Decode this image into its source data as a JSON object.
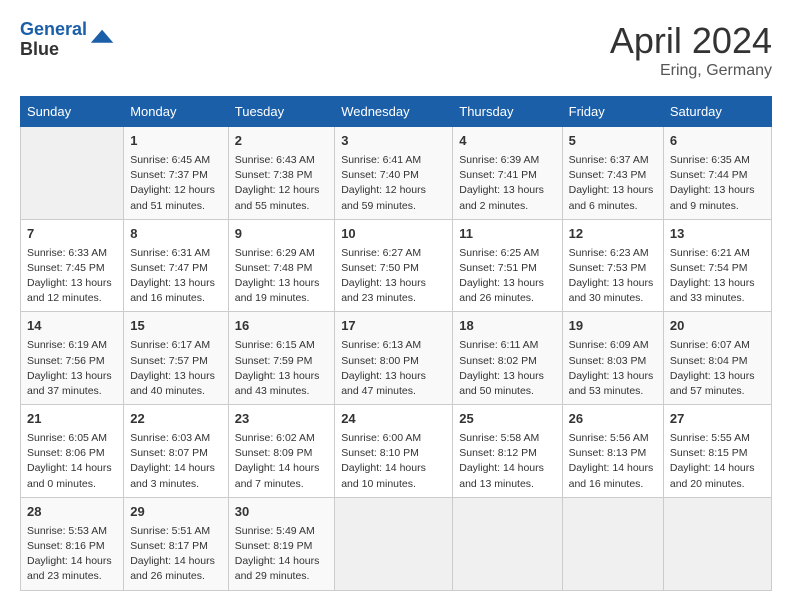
{
  "header": {
    "logo_line1": "General",
    "logo_line2": "Blue",
    "month": "April 2024",
    "location": "Ering, Germany"
  },
  "weekdays": [
    "Sunday",
    "Monday",
    "Tuesday",
    "Wednesday",
    "Thursday",
    "Friday",
    "Saturday"
  ],
  "weeks": [
    [
      {
        "day": "",
        "empty": true
      },
      {
        "day": "1",
        "sunrise": "6:45 AM",
        "sunset": "7:37 PM",
        "daylight": "12 hours and 51 minutes."
      },
      {
        "day": "2",
        "sunrise": "6:43 AM",
        "sunset": "7:38 PM",
        "daylight": "12 hours and 55 minutes."
      },
      {
        "day": "3",
        "sunrise": "6:41 AM",
        "sunset": "7:40 PM",
        "daylight": "12 hours and 59 minutes."
      },
      {
        "day": "4",
        "sunrise": "6:39 AM",
        "sunset": "7:41 PM",
        "daylight": "13 hours and 2 minutes."
      },
      {
        "day": "5",
        "sunrise": "6:37 AM",
        "sunset": "7:43 PM",
        "daylight": "13 hours and 6 minutes."
      },
      {
        "day": "6",
        "sunrise": "6:35 AM",
        "sunset": "7:44 PM",
        "daylight": "13 hours and 9 minutes."
      }
    ],
    [
      {
        "day": "7",
        "sunrise": "6:33 AM",
        "sunset": "7:45 PM",
        "daylight": "13 hours and 12 minutes."
      },
      {
        "day": "8",
        "sunrise": "6:31 AM",
        "sunset": "7:47 PM",
        "daylight": "13 hours and 16 minutes."
      },
      {
        "day": "9",
        "sunrise": "6:29 AM",
        "sunset": "7:48 PM",
        "daylight": "13 hours and 19 minutes."
      },
      {
        "day": "10",
        "sunrise": "6:27 AM",
        "sunset": "7:50 PM",
        "daylight": "13 hours and 23 minutes."
      },
      {
        "day": "11",
        "sunrise": "6:25 AM",
        "sunset": "7:51 PM",
        "daylight": "13 hours and 26 minutes."
      },
      {
        "day": "12",
        "sunrise": "6:23 AM",
        "sunset": "7:53 PM",
        "daylight": "13 hours and 30 minutes."
      },
      {
        "day": "13",
        "sunrise": "6:21 AM",
        "sunset": "7:54 PM",
        "daylight": "13 hours and 33 minutes."
      }
    ],
    [
      {
        "day": "14",
        "sunrise": "6:19 AM",
        "sunset": "7:56 PM",
        "daylight": "13 hours and 37 minutes."
      },
      {
        "day": "15",
        "sunrise": "6:17 AM",
        "sunset": "7:57 PM",
        "daylight": "13 hours and 40 minutes."
      },
      {
        "day": "16",
        "sunrise": "6:15 AM",
        "sunset": "7:59 PM",
        "daylight": "13 hours and 43 minutes."
      },
      {
        "day": "17",
        "sunrise": "6:13 AM",
        "sunset": "8:00 PM",
        "daylight": "13 hours and 47 minutes."
      },
      {
        "day": "18",
        "sunrise": "6:11 AM",
        "sunset": "8:02 PM",
        "daylight": "13 hours and 50 minutes."
      },
      {
        "day": "19",
        "sunrise": "6:09 AM",
        "sunset": "8:03 PM",
        "daylight": "13 hours and 53 minutes."
      },
      {
        "day": "20",
        "sunrise": "6:07 AM",
        "sunset": "8:04 PM",
        "daylight": "13 hours and 57 minutes."
      }
    ],
    [
      {
        "day": "21",
        "sunrise": "6:05 AM",
        "sunset": "8:06 PM",
        "daylight": "14 hours and 0 minutes."
      },
      {
        "day": "22",
        "sunrise": "6:03 AM",
        "sunset": "8:07 PM",
        "daylight": "14 hours and 3 minutes."
      },
      {
        "day": "23",
        "sunrise": "6:02 AM",
        "sunset": "8:09 PM",
        "daylight": "14 hours and 7 minutes."
      },
      {
        "day": "24",
        "sunrise": "6:00 AM",
        "sunset": "8:10 PM",
        "daylight": "14 hours and 10 minutes."
      },
      {
        "day": "25",
        "sunrise": "5:58 AM",
        "sunset": "8:12 PM",
        "daylight": "14 hours and 13 minutes."
      },
      {
        "day": "26",
        "sunrise": "5:56 AM",
        "sunset": "8:13 PM",
        "daylight": "14 hours and 16 minutes."
      },
      {
        "day": "27",
        "sunrise": "5:55 AM",
        "sunset": "8:15 PM",
        "daylight": "14 hours and 20 minutes."
      }
    ],
    [
      {
        "day": "28",
        "sunrise": "5:53 AM",
        "sunset": "8:16 PM",
        "daylight": "14 hours and 23 minutes."
      },
      {
        "day": "29",
        "sunrise": "5:51 AM",
        "sunset": "8:17 PM",
        "daylight": "14 hours and 26 minutes."
      },
      {
        "day": "30",
        "sunrise": "5:49 AM",
        "sunset": "8:19 PM",
        "daylight": "14 hours and 29 minutes."
      },
      {
        "day": "",
        "empty": true
      },
      {
        "day": "",
        "empty": true
      },
      {
        "day": "",
        "empty": true
      },
      {
        "day": "",
        "empty": true
      }
    ]
  ]
}
